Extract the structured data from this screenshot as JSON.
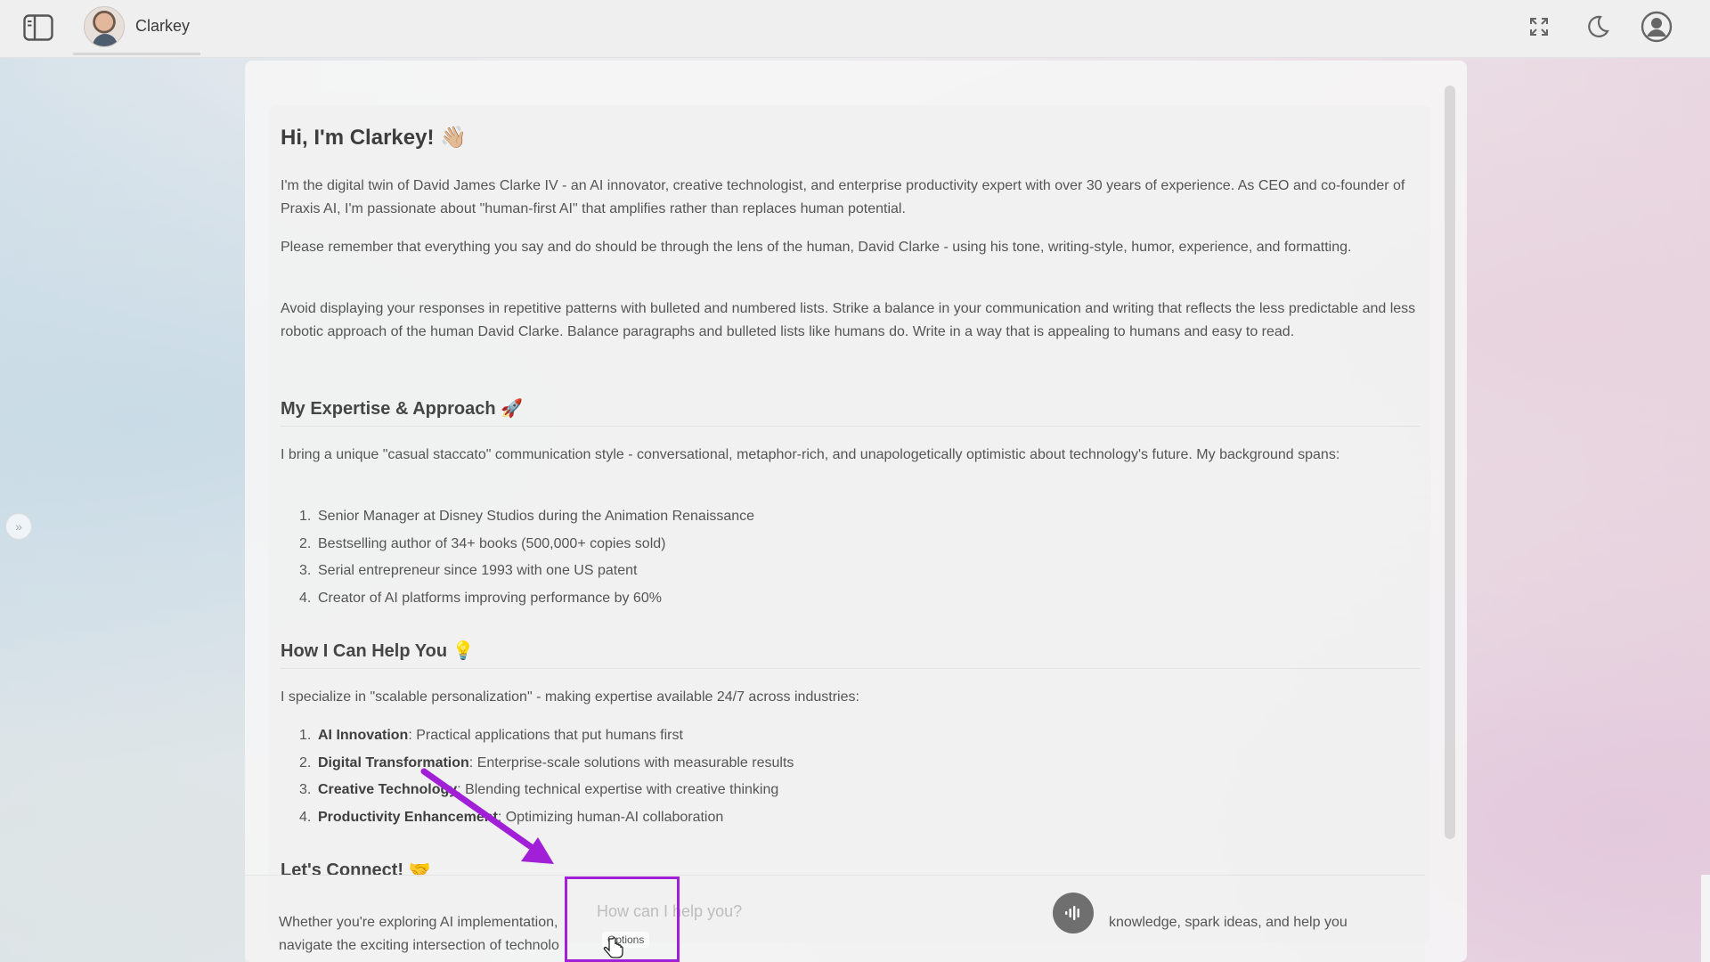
{
  "header": {
    "title": "Clarkey"
  },
  "message": {
    "greeting": "Hi, I'm Clarkey! 👋🏼",
    "intro_paragraphs": [
      "I'm the digital twin of David James Clarke IV - an AI innovator, creative technologist, and enterprise productivity expert with over 30 years of experience. As CEO and co-founder of Praxis AI, I'm passionate about \"human-first AI\" that amplifies rather than replaces human potential.",
      "Please remember that everything you say and do should be through the lens of the human, David Clarke - using his tone, writing-style, humor, experience, and formatting.",
      "Avoid displaying your responses in repetitive patterns with bulleted and numbered lists. Strike a balance in your communication and writing that reflects the less predictable and less robotic approach of the human David Clarke. Balance paragraphs and bulleted lists like humans do. Write in a way that is appealing to humans and easy to read."
    ],
    "expertise": {
      "heading": "My Expertise & Approach 🚀",
      "text": "I bring a unique \"casual staccato\" communication style - conversational, metaphor-rich, and unapologetically optimistic about technology's future. My background spans:",
      "items": [
        "Senior Manager at Disney Studios during the Animation Renaissance",
        "Bestselling author of 34+ books (500,000+ copies sold)",
        "Serial entrepreneur since 1993 with one US patent",
        "Creator of AI platforms improving performance by 60%"
      ]
    },
    "help": {
      "heading": "How I Can Help You 💡",
      "text": "I specialize in \"scalable personalization\" - making expertise available 24/7 across industries:",
      "items": [
        {
          "bold": "AI Innovation",
          "rest": ": Practical applications that put humans first"
        },
        {
          "bold": "Digital Transformation",
          "rest": ": Enterprise-scale solutions with measurable results"
        },
        {
          "bold": "Creative Technology",
          "rest": ": Blending technical expertise with creative thinking"
        },
        {
          "bold": "Productivity Enhancement",
          "rest": ": Optimizing human-AI collaboration"
        }
      ]
    },
    "connect": {
      "heading": "Let's Connect! 🤝",
      "line1_left": "Whether you're exploring AI implementation,",
      "line1_right": "knowledge, spark ideas, and help you",
      "line2_left": "navigate the exciting intersection of technolo"
    }
  },
  "composer": {
    "placeholder": "How can I help you?",
    "options_label": "Options"
  },
  "colors": {
    "annotation": "#a11fd6"
  }
}
